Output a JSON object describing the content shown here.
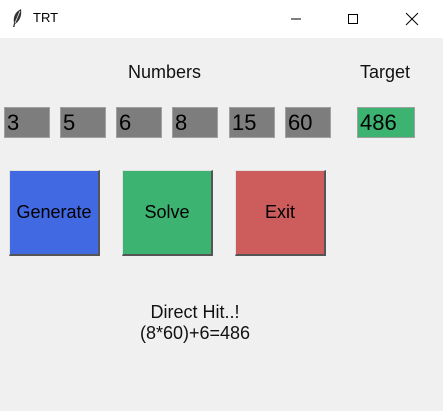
{
  "window": {
    "title": "TRT",
    "icons": {
      "app": "feather-icon",
      "minimize": "minimize-icon",
      "maximize": "maximize-icon",
      "close": "close-icon"
    }
  },
  "labels": {
    "numbers": "Numbers",
    "target": "Target"
  },
  "numbers": [
    "3",
    "5",
    "6",
    "8",
    "15",
    "60"
  ],
  "target": "486",
  "buttons": {
    "generate": "Generate",
    "solve": "Solve",
    "exit": "Exit"
  },
  "colors": {
    "generate": "#4169e1",
    "solve": "#3cb371",
    "exit": "#cd5c5c",
    "target_bg": "#3cb371",
    "number_bg": "#8c8c8c"
  },
  "result": {
    "status": "Direct Hit..!",
    "expression": "(8*60)+6=486"
  }
}
